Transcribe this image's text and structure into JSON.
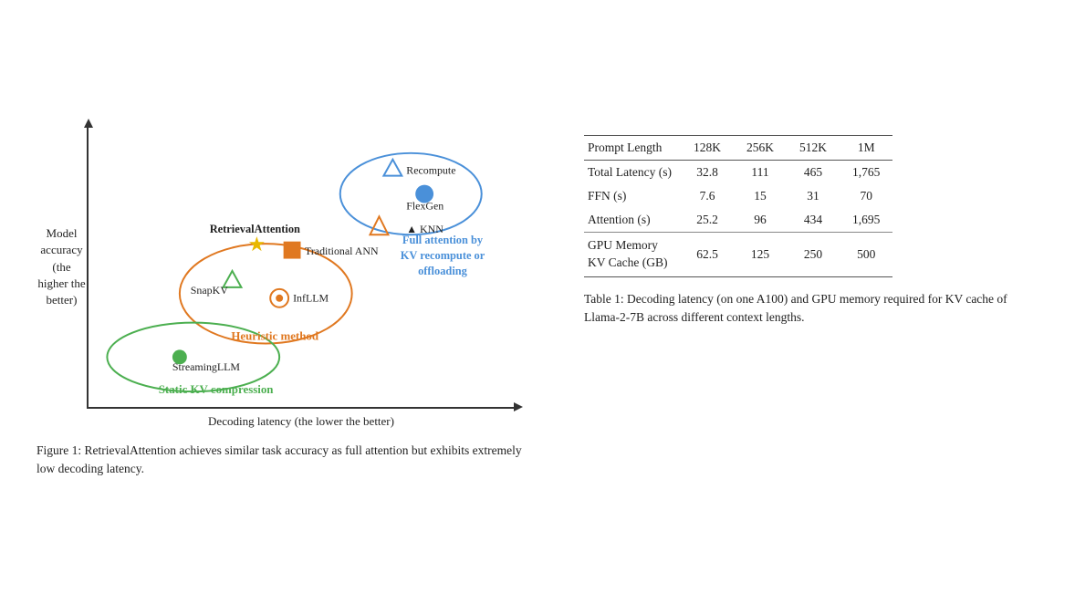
{
  "left": {
    "y_axis": {
      "line1": "Model",
      "line2": "accuracy",
      "line3": "(the",
      "line4": "higher",
      "line5": "the",
      "line6": "better)"
    },
    "x_axis_label": "Decoding latency (the lower the better)",
    "caption": "Figure 1: RetrievalAttention achieves similar task accuracy as full attention but exhibits extremely low decoding latency.",
    "annotations": {
      "retrieval_attention": "RetrievalAttention",
      "knn": "▲ KNN",
      "traditional_ann": "Traditional ANN",
      "full_attention_label": "Full attention by\nKV recompute or\noffloading",
      "heuristic_label": "Heuristic method",
      "static_kv_label": "Static KV compression",
      "snap_kv": "SnapKV",
      "inf_llm": "InfLLM",
      "recompute": "Recompute",
      "flexgen": "FlexGen",
      "streaming_llm": "StreamingLLM"
    }
  },
  "right": {
    "table_caption": "Table 1: Decoding latency (on one A100) and GPU memory required for KV cache of Llama-2-7B across different context lengths.",
    "headers": [
      "Prompt Length",
      "128K",
      "256K",
      "512K",
      "1M"
    ],
    "rows": [
      {
        "label": "Total Latency (s)",
        "vals": [
          "32.8",
          "111",
          "465",
          "1,765"
        ]
      },
      {
        "label": "FFN (s)",
        "vals": [
          "7.6",
          "15",
          "31",
          "70"
        ]
      },
      {
        "label": "Attention (s)",
        "vals": [
          "25.2",
          "96",
          "434",
          "1,695"
        ]
      },
      {
        "label": "GPU Memory\nKV Cache (GB)",
        "vals": [
          "62.5",
          "125",
          "250",
          "500"
        ],
        "section_break": true
      }
    ]
  }
}
